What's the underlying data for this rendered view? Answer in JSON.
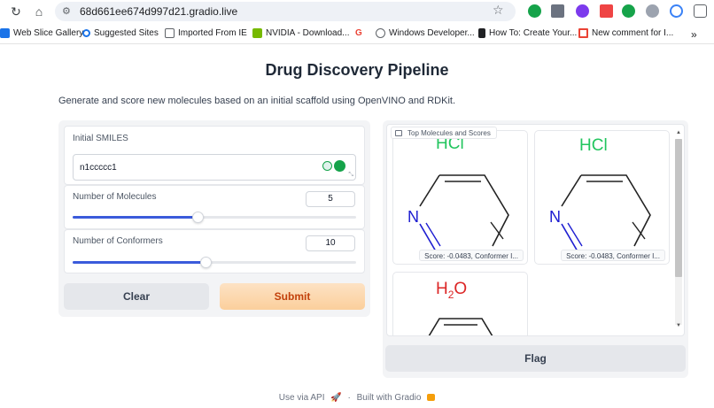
{
  "browser": {
    "url": "68d661ee674d997d21.gradio.live",
    "bookmarks": [
      {
        "label": "Web Slice Gallery",
        "icon": "web-slice-icon",
        "color": "#1a73e8"
      },
      {
        "label": "Suggested Sites",
        "icon": "search-icon",
        "color": "#1a73e8"
      },
      {
        "label": "Imported From IE",
        "icon": "folder-icon",
        "color": "#5f6368"
      },
      {
        "label": "NVIDIA - Download...",
        "icon": "nvidia-icon",
        "color": "#76b900"
      },
      {
        "label": "",
        "icon": "google-icon",
        "color": "#ea4335"
      },
      {
        "label": "Windows Developer...",
        "icon": "globe-icon",
        "color": "#5f6368"
      },
      {
        "label": "How To: Create Your...",
        "icon": "lock-icon",
        "color": "#202124"
      },
      {
        "label": "New comment for I...",
        "icon": "gmail-icon",
        "color": "#ea4335"
      }
    ]
  },
  "app": {
    "title": "Drug Discovery Pipeline",
    "description": "Generate and score new molecules based on an initial scaffold using OpenVINO and RDKit.",
    "smiles": {
      "label": "Initial SMILES",
      "value": "n1ccccc1"
    },
    "num_molecules": {
      "label": "Number of Molecules",
      "value": "5",
      "fraction": 0.44
    },
    "num_conformers": {
      "label": "Number of Conformers",
      "value": "10",
      "fraction": 0.47
    },
    "clear_label": "Clear",
    "submit_label": "Submit",
    "gallery": {
      "label": "Top Molecules and Scores",
      "items": [
        {
          "salt": "HCl",
          "caption": "Score: -0.0483, Conformer I..."
        },
        {
          "salt": "HCl",
          "caption": "Score: -0.0483, Conformer I..."
        },
        {
          "salt": "H2O",
          "caption": ""
        }
      ]
    },
    "flag_label": "Flag",
    "footer": {
      "api": "Use via API",
      "sep": "·",
      "built": "Built with Gradio"
    }
  },
  "colors": {
    "accent": "#3b5bdb",
    "submit": "#c2410c",
    "salt_green": "#22c55e",
    "salt_red": "#dc2626",
    "nitrogen": "#1d1dd1"
  }
}
